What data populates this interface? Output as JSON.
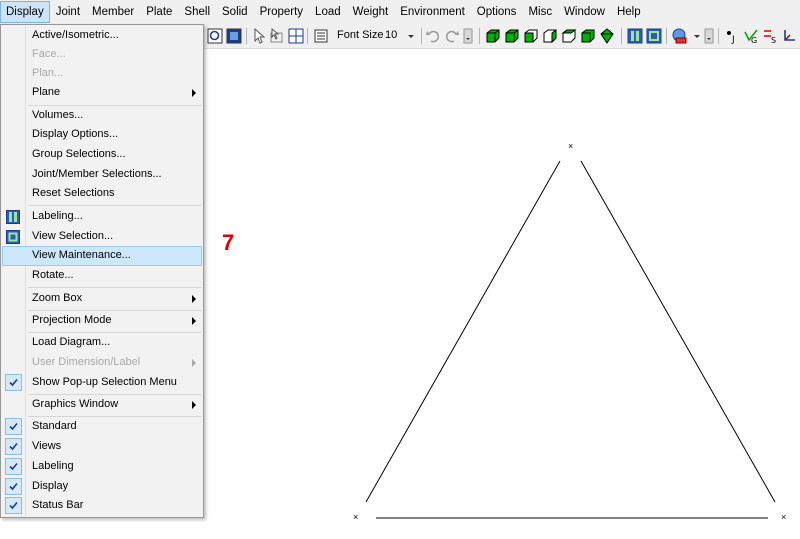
{
  "menubar": {
    "items": [
      "Display",
      "Joint",
      "Member",
      "Plate",
      "Shell",
      "Solid",
      "Property",
      "Load",
      "Weight",
      "Environment",
      "Options",
      "Misc",
      "Window",
      "Help"
    ]
  },
  "toolbar": {
    "font_size_label": "Font Size",
    "font_size_value": "10"
  },
  "display_menu": {
    "items": [
      {
        "label": "Active/Isometric..."
      },
      {
        "label": "Face..."
      },
      {
        "label": "Plan..."
      },
      {
        "label": "Plane"
      },
      {
        "label": "Volumes..."
      },
      {
        "label": "Display Options..."
      },
      {
        "label": "Group Selections..."
      },
      {
        "label": "Joint/Member Selections..."
      },
      {
        "label": "Reset Selections"
      },
      {
        "label": "Labeling..."
      },
      {
        "label": "View Selection..."
      },
      {
        "label": "View Maintenance..."
      },
      {
        "label": "Rotate..."
      },
      {
        "label": "Zoom Box"
      },
      {
        "label": "Projection Mode"
      },
      {
        "label": "Load Diagram..."
      },
      {
        "label": "User Dimension/Label"
      },
      {
        "label": "Show Pop-up Selection Menu"
      },
      {
        "label": "Graphics Window"
      },
      {
        "label": "Standard"
      },
      {
        "label": "Views"
      },
      {
        "label": "Labeling"
      },
      {
        "label": "Display"
      },
      {
        "label": "Status Bar"
      }
    ]
  },
  "annotation": {
    "text": "7",
    "color": "#e00000"
  },
  "colors": {
    "highlight": "#cce8ff",
    "menu_bg": "#f2f2f2",
    "shape_icon": "#00b000"
  }
}
